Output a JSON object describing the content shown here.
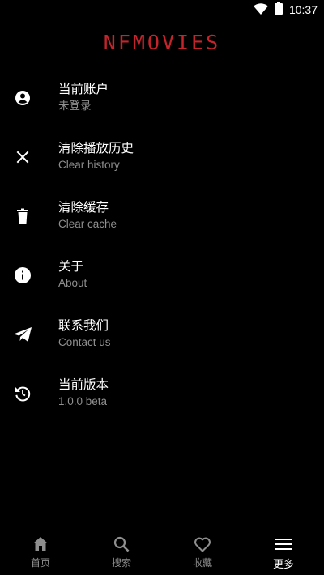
{
  "status_bar": {
    "time": "10:37",
    "icons": [
      "wifi-icon",
      "battery-icon"
    ]
  },
  "app": {
    "logo_text": "NFMOVIES",
    "accent": "#c4242b"
  },
  "menu": {
    "items": [
      {
        "icon": "account-circle-icon",
        "title": "当前账户",
        "subtitle": "未登录"
      },
      {
        "icon": "close-icon",
        "title": "清除播放历史",
        "subtitle": "Clear history"
      },
      {
        "icon": "trash-icon",
        "title": "清除缓存",
        "subtitle": "Clear cache"
      },
      {
        "icon": "info-icon",
        "title": "关于",
        "subtitle": "About"
      },
      {
        "icon": "send-icon",
        "title": "联系我们",
        "subtitle": "Contact us"
      },
      {
        "icon": "update-icon",
        "title": "当前版本",
        "subtitle": "1.0.0 beta"
      }
    ]
  },
  "bottom_nav": {
    "items": [
      {
        "icon": "home-icon",
        "label": "首页",
        "active": false
      },
      {
        "icon": "search-icon",
        "label": "搜索",
        "active": false
      },
      {
        "icon": "heart-icon",
        "label": "收藏",
        "active": false
      },
      {
        "icon": "menu-icon",
        "label": "更多",
        "active": true
      }
    ]
  },
  "colors": {
    "background": "#000000",
    "text_primary": "#ffffff",
    "text_secondary": "#8f8f8f"
  }
}
